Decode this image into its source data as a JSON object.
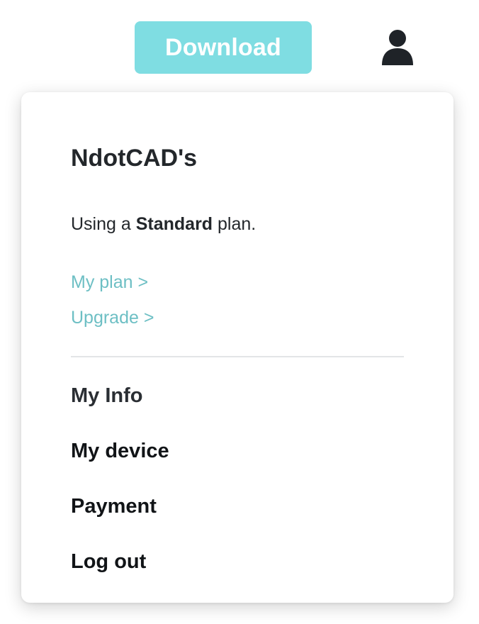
{
  "header": {
    "download_label": "Download",
    "download_color": "#7fdde2",
    "user_icon": "user-icon"
  },
  "dropdown": {
    "account_name": "NdotCAD's",
    "plan_prefix": "Using a ",
    "plan_name": "Standard",
    "plan_suffix": " plan.",
    "links": {
      "my_plan": "My plan >",
      "upgrade": "Upgrade >",
      "color": "#6dbfc4"
    },
    "menu": {
      "my_info": "My Info",
      "my_device": "My device",
      "payment": "Payment",
      "log_out": "Log out"
    }
  }
}
